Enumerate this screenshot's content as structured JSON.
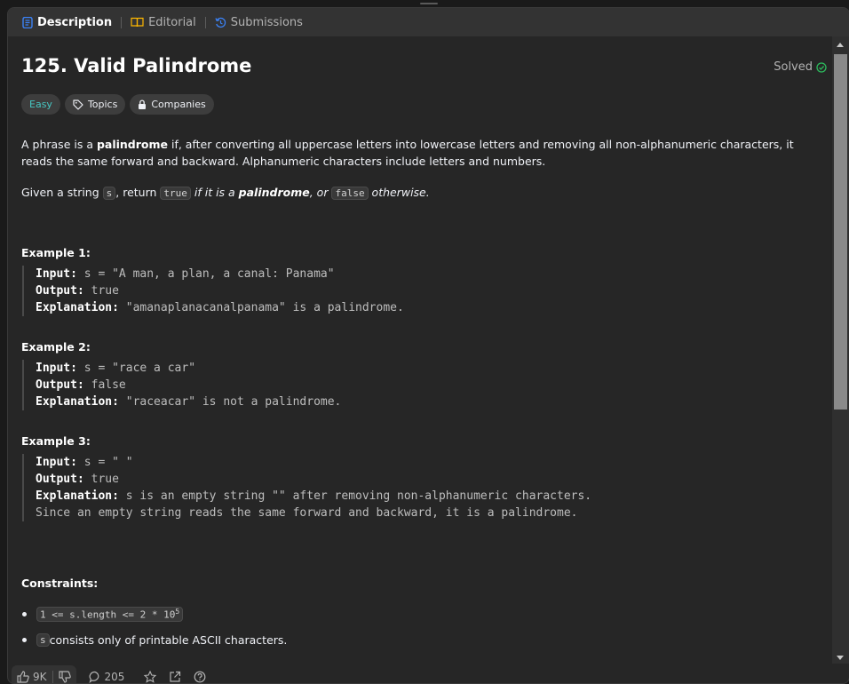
{
  "tabs": [
    {
      "label": "Description",
      "icon": "description-icon",
      "active": true
    },
    {
      "label": "Editorial",
      "icon": "book-icon",
      "active": false
    },
    {
      "label": "Submissions",
      "icon": "history-icon",
      "active": false
    }
  ],
  "problem": {
    "title": "125. Valid Palindrome",
    "status": "Solved",
    "difficulty": "Easy",
    "topics_label": "Topics",
    "companies_label": "Companies"
  },
  "description": {
    "p1_a": "A phrase is a ",
    "p1_b": "palindrome",
    "p1_c": " if, after converting all uppercase letters into lowercase letters and removing all non-alphanumeric characters, it reads the same forward and backward. Alphanumeric characters include letters and numbers.",
    "p2_a": "Given a string ",
    "p2_code1": "s",
    "p2_b": ", return ",
    "p2_code2": "true",
    "p2_c": " if it is a ",
    "p2_d": "palindrome",
    "p2_e": ", or ",
    "p2_code3": "false",
    "p2_f": " otherwise."
  },
  "examples": [
    {
      "heading": "Example 1:",
      "input_label": "Input:",
      "input": " s = \"A man, a plan, a canal: Panama\"",
      "output_label": "Output:",
      "output": " true",
      "explanation_label": "Explanation:",
      "explanation": " \"amanaplanacanalpanama\" is a palindrome."
    },
    {
      "heading": "Example 2:",
      "input_label": "Input:",
      "input": " s = \"race a car\"",
      "output_label": "Output:",
      "output": " false",
      "explanation_label": "Explanation:",
      "explanation": " \"raceacar\" is not a palindrome."
    },
    {
      "heading": "Example 3:",
      "input_label": "Input:",
      "input": " s = \" \"",
      "output_label": "Output:",
      "output": " true",
      "explanation_label": "Explanation:",
      "explanation": " s is an empty string \"\" after removing non-alphanumeric characters.",
      "explanation_2": "Since an empty string reads the same forward and backward, it is a palindrome."
    }
  ],
  "constraints": {
    "heading": "Constraints:",
    "c1_code": "1 <= s.length <= 2 * 10",
    "c1_sup": "5",
    "c2_code": "s",
    "c2_text": " consists only of printable ASCII characters."
  },
  "footer": {
    "likes": "9K",
    "comments": "205"
  },
  "colors": {
    "easy": "#46c6c2",
    "solved": "#2cbb5d",
    "description_icon": "#3b82f6",
    "editorial_icon": "#ffb800",
    "submissions_icon": "#3b82f6"
  }
}
